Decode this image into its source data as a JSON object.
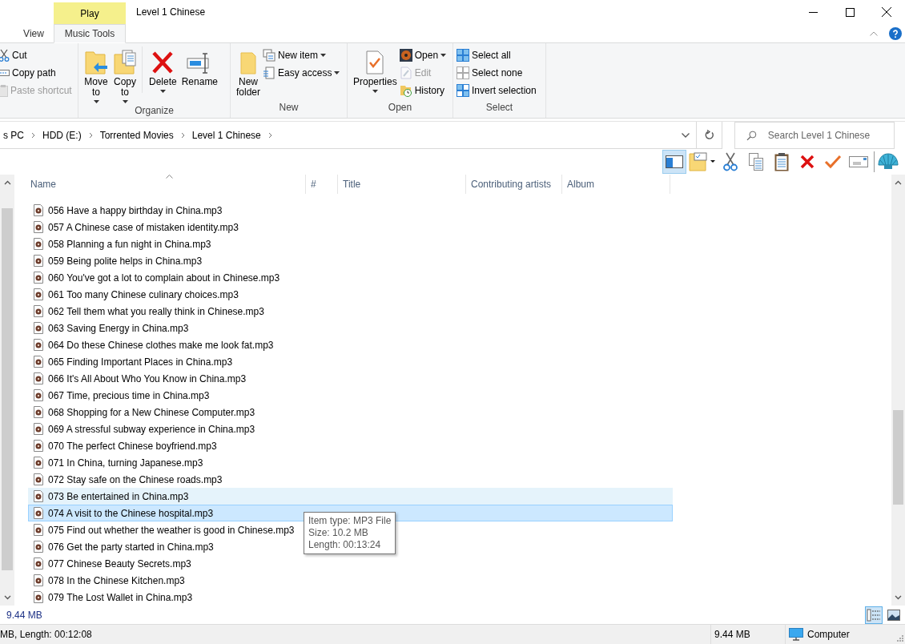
{
  "window": {
    "title": "Level 1 Chinese",
    "context_tab": "Play"
  },
  "tabs": [
    {
      "label": "View",
      "selected": false
    },
    {
      "label": "Music Tools",
      "selected": true
    }
  ],
  "ribbon": {
    "clipboard": [
      {
        "label": "Cut",
        "disabled": false
      },
      {
        "label": "Copy path",
        "disabled": false
      },
      {
        "label": "Paste shortcut",
        "disabled": true
      }
    ],
    "organize": {
      "label": "Organize",
      "buttons": [
        {
          "lines": [
            "Move",
            "to"
          ],
          "dropdown": true
        },
        {
          "lines": [
            "Copy",
            "to"
          ],
          "dropdown": true
        },
        {
          "lines": [
            "Delete"
          ],
          "dropdown": true
        },
        {
          "lines": [
            "Rename"
          ],
          "dropdown": false
        }
      ]
    },
    "new": {
      "label": "New",
      "folder": [
        "New",
        "folder"
      ],
      "items": [
        {
          "label": "New item",
          "dropdown": true
        },
        {
          "label": "Easy access",
          "dropdown": true
        }
      ]
    },
    "open": {
      "label": "Open",
      "properties": "Properties",
      "items": [
        {
          "label": "Open",
          "dropdown": true,
          "disabled": false
        },
        {
          "label": "Edit",
          "dropdown": false,
          "disabled": true
        },
        {
          "label": "History",
          "dropdown": false,
          "disabled": false
        }
      ]
    },
    "select": {
      "label": "Select",
      "items": [
        "Select all",
        "Select none",
        "Invert selection"
      ]
    }
  },
  "address": {
    "crumbs": [
      "s PC",
      "HDD (E:)",
      "Torrented Movies",
      "Level 1 Chinese"
    ]
  },
  "search": {
    "placeholder": "Search Level 1 Chinese"
  },
  "toolbar": [
    {
      "kind": "pane",
      "selected": true
    },
    {
      "kind": "folder",
      "selected": false
    },
    {
      "kind": "cut",
      "selected": false
    },
    {
      "kind": "copy",
      "selected": false
    },
    {
      "kind": "paste",
      "selected": false
    },
    {
      "kind": "delete",
      "selected": false
    },
    {
      "kind": "check",
      "selected": false
    },
    {
      "kind": "mail",
      "selected": false
    },
    {
      "kind": "shell",
      "selected": false
    }
  ],
  "columns": [
    {
      "label": "Name",
      "sorted": true
    },
    {
      "label": "#",
      "sorted": false
    },
    {
      "label": "Title",
      "sorted": false
    },
    {
      "label": "Contributing artists",
      "sorted": false
    },
    {
      "label": "Album",
      "sorted": false
    }
  ],
  "files": [
    {
      "name": "056 Have a happy birthday in China.mp3",
      "selected": false,
      "hot": false
    },
    {
      "name": "057 A Chinese case of mistaken identity.mp3",
      "selected": false,
      "hot": false
    },
    {
      "name": "058 Planning a fun night in China.mp3",
      "selected": false,
      "hot": false
    },
    {
      "name": "059 Being polite helps in China.mp3",
      "selected": false,
      "hot": false
    },
    {
      "name": "060 You've got a lot to complain about in Chinese.mp3",
      "selected": false,
      "hot": false
    },
    {
      "name": "061 Too many Chinese culinary choices.mp3",
      "selected": false,
      "hot": false
    },
    {
      "name": "062 Tell them what you really think in Chinese.mp3",
      "selected": false,
      "hot": false
    },
    {
      "name": "063 Saving Energy in China.mp3",
      "selected": false,
      "hot": false
    },
    {
      "name": "064 Do these Chinese clothes make me look fat.mp3",
      "selected": false,
      "hot": false
    },
    {
      "name": "065 Finding Important Places in China.mp3",
      "selected": false,
      "hot": false
    },
    {
      "name": "066 It's All About Who You Know in China.mp3",
      "selected": false,
      "hot": false
    },
    {
      "name": "067 Time, precious time in China.mp3",
      "selected": false,
      "hot": false
    },
    {
      "name": "068 Shopping for a New Chinese Computer.mp3",
      "selected": false,
      "hot": false
    },
    {
      "name": "069 A stressful subway experience in China.mp3",
      "selected": false,
      "hot": false
    },
    {
      "name": "070 The perfect Chinese boyfriend.mp3",
      "selected": false,
      "hot": false
    },
    {
      "name": "071 In China, turning Japanese.mp3",
      "selected": false,
      "hot": false
    },
    {
      "name": "072 Stay safe on the Chinese roads.mp3",
      "selected": false,
      "hot": false
    },
    {
      "name": "073 Be entertained in China.mp3",
      "selected": false,
      "hot": true
    },
    {
      "name": "074 A visit to the Chinese hospital.mp3",
      "selected": true,
      "hot": false
    },
    {
      "name": "075 Find out whether the weather is good in Chinese.mp3",
      "selected": false,
      "hot": false
    },
    {
      "name": "076 Get the party started in China.mp3",
      "selected": false,
      "hot": false
    },
    {
      "name": "077 Chinese Beauty Secrets.mp3",
      "selected": false,
      "hot": false
    },
    {
      "name": "078 In the Chinese Kitchen.mp3",
      "selected": false,
      "hot": false
    },
    {
      "name": "079 The Lost Wallet in China.mp3",
      "selected": false,
      "hot": false
    }
  ],
  "tooltip": [
    "Item type: MP3 File",
    "Size: 10.2 MB",
    "Length: 00:13:24"
  ],
  "details_size": "9.44 MB",
  "views": [
    {
      "kind": "details",
      "selected": true
    },
    {
      "kind": "large",
      "selected": false
    }
  ],
  "status_bar": {
    "details": "MB, Length: 00:12:08",
    "size": "9.44 MB",
    "zone": "Computer"
  }
}
